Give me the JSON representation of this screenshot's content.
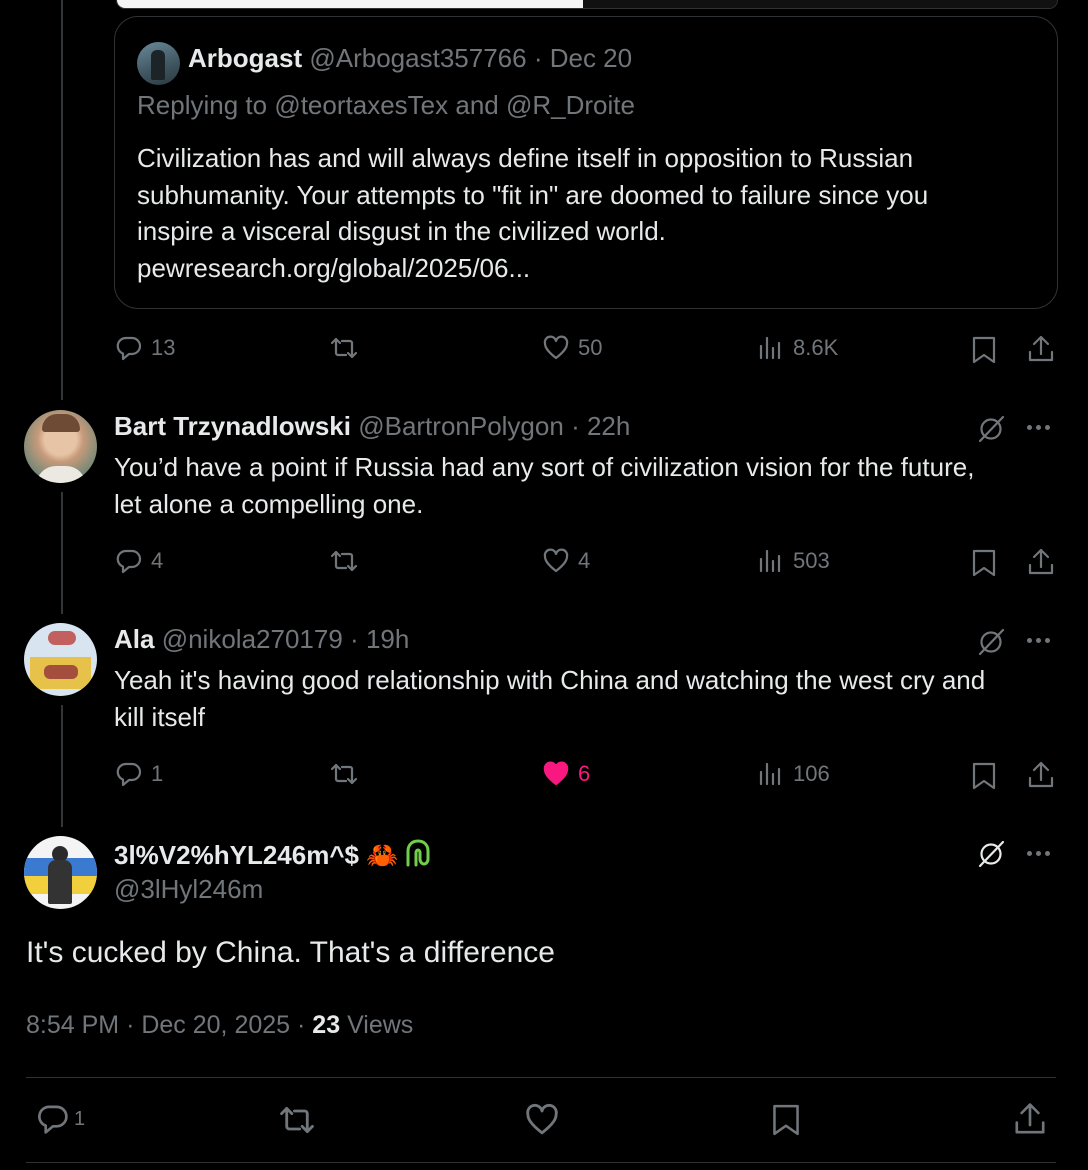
{
  "quoted_post": {
    "author_name": "Arbogast",
    "handle": "@Arbogast357766",
    "date": "Dec 20",
    "replying_prefix": "Replying to",
    "replying_to_1": "@teortaxesTex",
    "replying_and": "and",
    "replying_to_2": "@R_Droite",
    "line1": "Civilization has and will always define itself in opposition to Russian",
    "line2": "subhumanity. Your attempts to \"fit in\" are doomed to failure since you",
    "line3": "inspire a visceral disgust in the civilized world.",
    "line4": "pewresearch.org/global/2025/06...",
    "stats": {
      "replies": "13",
      "likes": "50",
      "views": "8.6K"
    }
  },
  "reply1": {
    "author_name": "Bart Trzynadlowski",
    "handle": "@BartronPolygon",
    "time": "22h",
    "line1": "You’d have a point if Russia had any sort of civilization vision for the future,",
    "line2": "let alone a compelling one.",
    "stats": {
      "replies": "4",
      "likes": "4",
      "views": "503"
    }
  },
  "reply2": {
    "author_name": "Ala",
    "handle": "@nikola270179",
    "time": "19h",
    "line1": "Yeah it's having good relationship with China and watching the west cry and",
    "line2": "kill itself",
    "stats": {
      "replies": "1",
      "likes": "6",
      "views": "106"
    }
  },
  "main_post": {
    "author_name": "3l%V2%hYL246m^$",
    "emoji": "🦀",
    "handle": "@3lHyl246m",
    "text": "It's cucked by China. That's a difference",
    "time": "8:54 PM",
    "date": "Dec 20, 2025",
    "views_count": "23",
    "views_label": "Views",
    "replies": "1"
  },
  "separator": "·",
  "colors": {
    "background": "#000000",
    "text": "#e7e9ea",
    "muted": "#71767b",
    "like_active": "#f91880",
    "border": "#2f3336"
  }
}
